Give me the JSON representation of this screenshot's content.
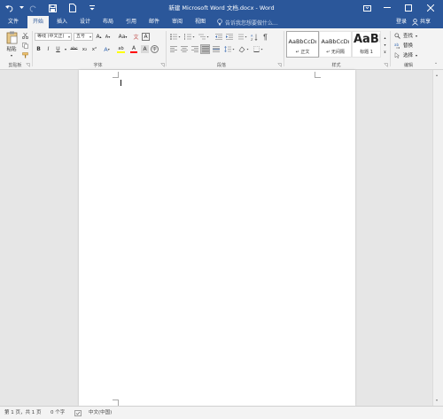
{
  "window": {
    "title": "新建 Microsoft Word 文档.docx - Word"
  },
  "tabs": [
    {
      "label": "文件"
    },
    {
      "label": "开始"
    },
    {
      "label": "插入"
    },
    {
      "label": "设计"
    },
    {
      "label": "布局"
    },
    {
      "label": "引用"
    },
    {
      "label": "邮件"
    },
    {
      "label": "审阅"
    },
    {
      "label": "视图"
    }
  ],
  "tell_me": {
    "placeholder": "告诉我您想要做什么..."
  },
  "account": {
    "login_label": "登录",
    "share_label": "共享"
  },
  "ribbon": {
    "clipboard": {
      "paste_label": "粘贴",
      "group_label": "剪贴板"
    },
    "font": {
      "font_name": "等线 (中文正)",
      "font_size": "五号",
      "group_label": "字体",
      "buttons": [
        "A",
        "A",
        "Aa",
        "文",
        "A",
        "B",
        "I",
        "U",
        "abc",
        "x₂",
        "x²",
        "A",
        "ab",
        "A",
        "A",
        "字"
      ]
    },
    "paragraph": {
      "group_label": "段落"
    },
    "styles": {
      "group_label": "样式",
      "items": [
        {
          "sample": "AaBbCcDı",
          "name": "↵ 正文"
        },
        {
          "sample": "AaBbCcDı",
          "name": "↵ 无间隔"
        },
        {
          "sample": "AaBl",
          "name": "标题 1"
        }
      ]
    },
    "editing": {
      "group_label": "编辑",
      "find_label": "查找",
      "replace_label": "替换",
      "select_label": "选择"
    }
  },
  "status": {
    "page": "第 1 页，共 1 页",
    "words": "0 个字",
    "language": "中文(中国)"
  },
  "colors": {
    "brand": "#2b579a",
    "highlight": "#ffff00",
    "font_color": "#ff0000"
  }
}
